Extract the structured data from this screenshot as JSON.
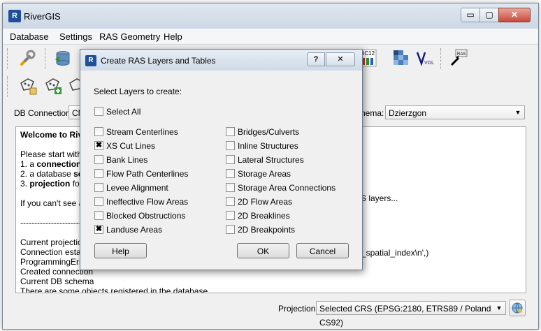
{
  "app": {
    "title": "RiverGIS",
    "logo_text": "R"
  },
  "window_controls": {
    "minimize": "▭",
    "maximize": "▢",
    "close": "✕"
  },
  "menu": [
    "Database",
    "Settings",
    "RAS Geometry",
    "Help"
  ],
  "toolbar": {
    "icons": [
      "wrench-icon",
      "database-icon",
      "ras-icon-1",
      "ras-icon-2",
      "ras-icon-3",
      "ras-icon-4",
      "bc-icon",
      "grid-icon",
      "volume-icon",
      "ras-export-icon"
    ],
    "second_row_icons": [
      "add-layer-icon",
      "add-layer-green-icon",
      "add-layer-3-icon"
    ],
    "vol_label": "VOL",
    "ras_label": "RAS",
    "bc_label": "BC12"
  },
  "db_connection": {
    "label": "DB Connection:",
    "value": "CM"
  },
  "schema": {
    "label": "hema:",
    "value": "Dzierzgon"
  },
  "log": [
    {
      "text": "Welcome to Rive",
      "bold": true
    },
    {
      "text": "",
      "bold": false
    },
    {
      "text": "Please start with c",
      "bold": false
    },
    {
      "text": "1. a connection",
      "bold": false
    },
    {
      "text": "2. a database sch",
      "bold": false
    },
    {
      "text": "3. projection for",
      "bold": false
    },
    {
      "text": "",
      "bold": false
    },
    {
      "text": "If you can't see an",
      "bold": false
    },
    {
      "text": "",
      "bold": false
    },
    {
      "text": "-----------------------",
      "bold": false
    },
    {
      "text": "",
      "bold": false
    },
    {
      "text": "Current projection",
      "bold": false
    },
    {
      "text": "Connection establi",
      "bold": false
    },
    {
      "text": "ProgrammingError(",
      "bold": false
    },
    {
      "text": "Created connection",
      "bold": false
    },
    {
      "text": "Current DB schema",
      "bold": false
    },
    {
      "text": "There are some objects registered in the database.",
      "bold": false
    }
  ],
  "log_right": {
    "layers_tail": "S layers...",
    "index_tail": "_spatial_index\\n',)"
  },
  "projection": {
    "label": "Projection",
    "value": "Selected CRS (EPSG:2180, ETRS89 / Poland CS92)"
  },
  "dialog": {
    "title": "Create RAS Layers and Tables",
    "help_glyph": "?",
    "close_glyph": "✕",
    "prompt": "Select Layers to create:",
    "select_all": "Select All",
    "left_layers": [
      {
        "label": "Stream Centerlines",
        "checked": false
      },
      {
        "label": "XS Cut Lines",
        "checked": true
      },
      {
        "label": "Bank Lines",
        "checked": false
      },
      {
        "label": "Flow Path Centerlines",
        "checked": false
      },
      {
        "label": "Levee Alignment",
        "checked": false
      },
      {
        "label": "Ineffective Flow Areas",
        "checked": false
      },
      {
        "label": "Blocked Obstructions",
        "checked": false
      },
      {
        "label": "Landuse Areas",
        "checked": true
      }
    ],
    "right_layers": [
      {
        "label": "Bridges/Culverts",
        "checked": false
      },
      {
        "label": "Inline Structures",
        "checked": false
      },
      {
        "label": "Lateral Structures",
        "checked": false
      },
      {
        "label": "Storage Areas",
        "checked": false
      },
      {
        "label": "Storage Area Connections",
        "checked": false
      },
      {
        "label": "2D Flow Areas",
        "checked": false
      },
      {
        "label": "2D Breaklines",
        "checked": false
      },
      {
        "label": "2D Breakpoints",
        "checked": false
      }
    ],
    "buttons": {
      "help": "Help",
      "ok": "OK",
      "cancel": "Cancel"
    }
  },
  "colors": {
    "accent": "#1f4f9a",
    "close_red": "#c9483a"
  }
}
